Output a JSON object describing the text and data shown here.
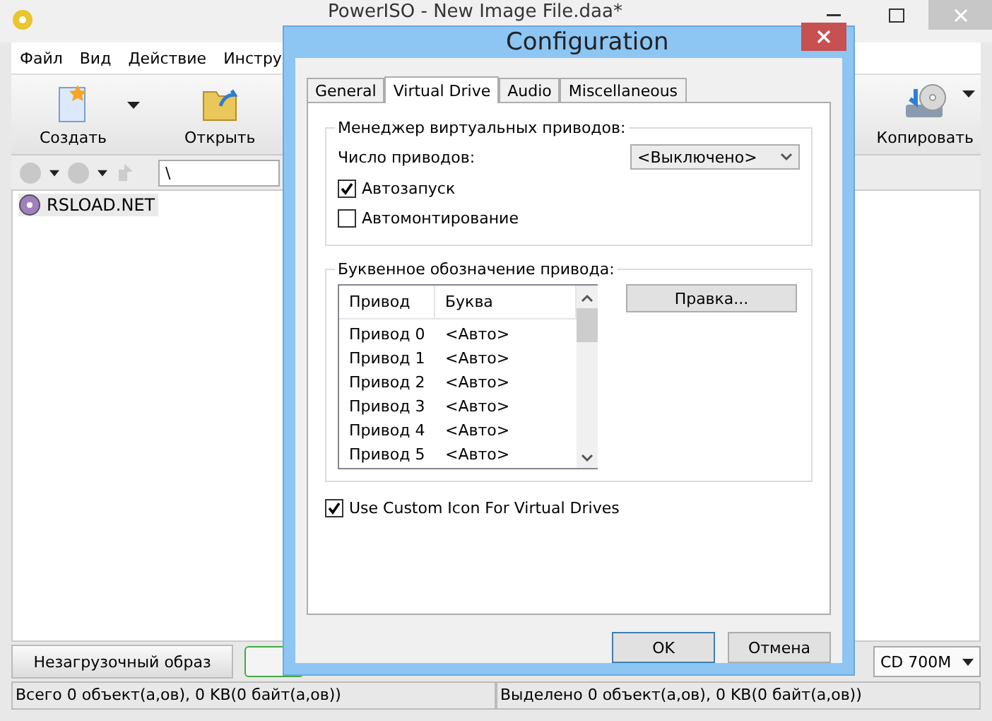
{
  "main_window": {
    "title": "PowerISO - New Image File.daa*",
    "menu": [
      "Файл",
      "Вид",
      "Действие",
      "Инстру"
    ],
    "toolbar": [
      {
        "label": "Создать",
        "kind": "new",
        "dropdown": true
      },
      {
        "label": "Открыть",
        "kind": "open",
        "dropdown": false
      },
      {
        "label": "Копировать",
        "kind": "copy",
        "dropdown": true
      }
    ],
    "address": "\\",
    "tree": [
      {
        "label": "RSLOAD.NET",
        "selected": true
      }
    ],
    "boot_button": "Незагрузочный образ",
    "capacity": "CD 700M",
    "status_bar": [
      "Всего 0 объект(а,ов), 0 KB(0 байт(а,ов))",
      "Выделено 0 объект(а,ов), 0 KB(0 байт(а,ов))"
    ]
  },
  "dialog": {
    "title": "Configuration",
    "tabs": [
      {
        "label": "General",
        "selected": false
      },
      {
        "label": "Virtual Drive",
        "selected": true
      },
      {
        "label": "Audio",
        "selected": false
      },
      {
        "label": "Miscellaneous",
        "selected": false
      }
    ],
    "manager_group": {
      "title": "Менеджер виртуальных приводов:",
      "count_label": "Число приводов:",
      "count_value": "<Выключено>",
      "options": [
        {
          "label": "Автозапуск",
          "checked": true
        },
        {
          "label": "Автомонтирование",
          "checked": false
        }
      ]
    },
    "letters_group": {
      "title": "Буквенное обозначение привода:",
      "columns": [
        "Привод",
        "Буква"
      ],
      "rows": [
        [
          "Привод 0",
          "<Авто>"
        ],
        [
          "Привод 1",
          "<Авто>"
        ],
        [
          "Привод 2",
          "<Авто>"
        ],
        [
          "Привод 3",
          "<Авто>"
        ],
        [
          "Привод 4",
          "<Авто>"
        ],
        [
          "Привод 5",
          "<Авто>"
        ]
      ],
      "edit_button": "Правка..."
    },
    "custom_icon": {
      "label": "Use Custom Icon For Virtual Drives",
      "checked": true
    },
    "buttons": [
      "OK",
      "Отмена"
    ]
  }
}
